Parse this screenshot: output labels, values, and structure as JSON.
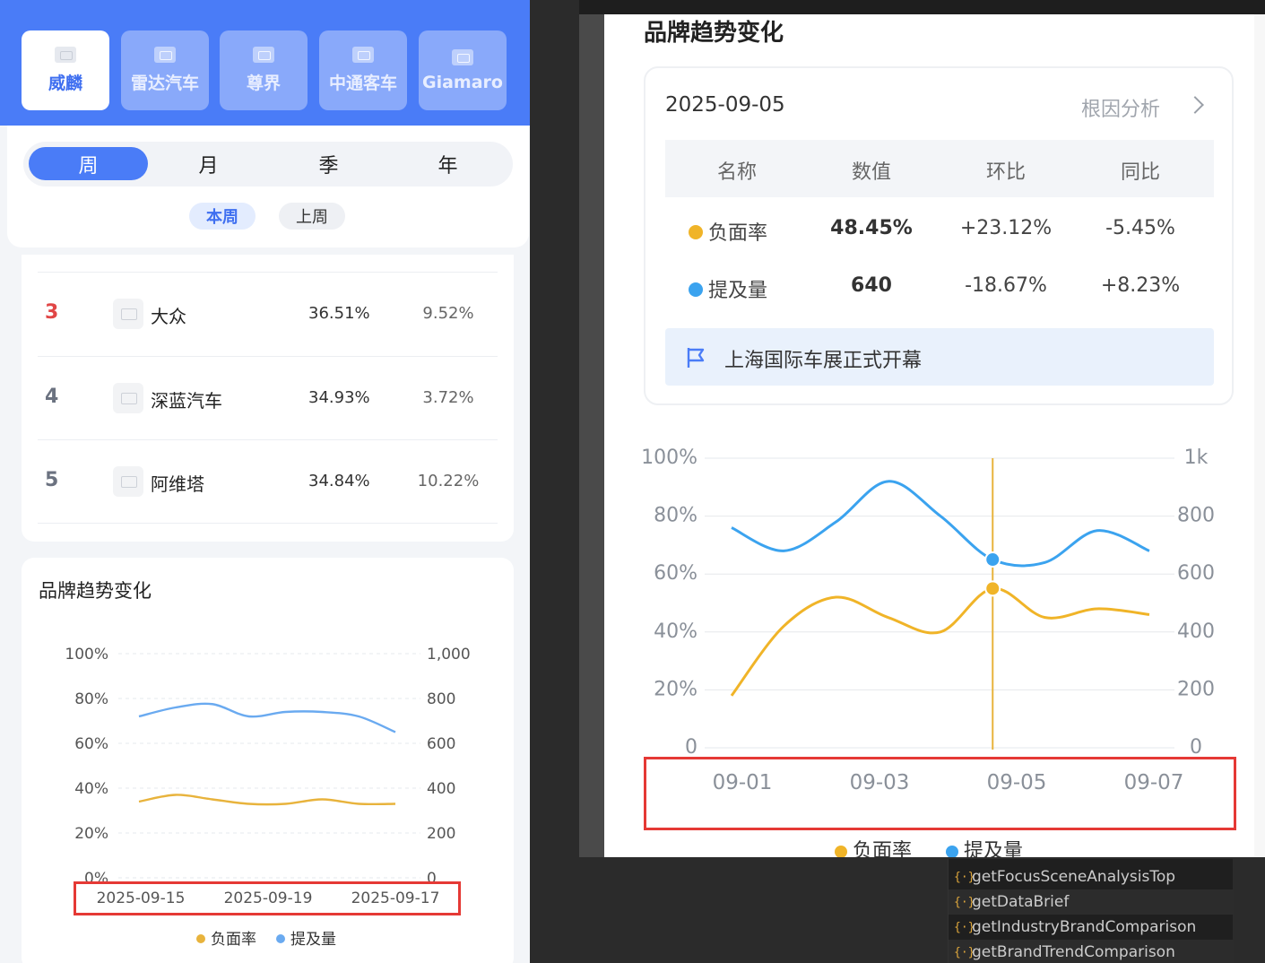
{
  "left_panel": {
    "brands": [
      "威麟",
      "雷达汽车",
      "尊界",
      "中通客车",
      "Giamaro"
    ],
    "period_tabs": [
      "周",
      "月",
      "季",
      "年"
    ],
    "sub_tabs": [
      "本周",
      "上周"
    ],
    "ranking_rows": [
      {
        "rank": "3",
        "name": "大众",
        "value1": "36.51%",
        "value2": "9.52%"
      },
      {
        "rank": "4",
        "name": "深蓝汽车",
        "value1": "34.93%",
        "value2": "3.72%"
      },
      {
        "rank": "5",
        "name": "阿维塔",
        "value1": "34.84%",
        "value2": "10.22%"
      }
    ],
    "trend_title": "品牌趋势变化"
  },
  "right_panel": {
    "title": "品牌趋势变化",
    "date": "2025-09-05",
    "root_cause_link": "根因分析",
    "table_headers": [
      "名称",
      "数值",
      "环比",
      "同比"
    ],
    "table_rows": [
      {
        "name": "负面率",
        "value": "48.45%",
        "mom": "+23.12%",
        "yoy": "-5.45%",
        "color": "#f0b428"
      },
      {
        "name": "提及量",
        "value": "640",
        "mom": "-18.67%",
        "yoy": "+8.23%",
        "color": "#3ba3ef"
      }
    ],
    "event": "上海国际车展正式开幕"
  },
  "chart_data": [
    {
      "type": "line",
      "x_labels": [
        "2025-09-15",
        "2025-09-19",
        "2025-09-17"
      ],
      "left_axis_ticks": [
        "100%",
        "80%",
        "60%",
        "40%",
        "20%",
        "0%"
      ],
      "right_axis_ticks": [
        "1,000",
        "800",
        "600",
        "400",
        "200",
        "0"
      ],
      "ylim_left": [
        0,
        100
      ],
      "ylim_right": [
        0,
        1000
      ],
      "series": [
        {
          "name": "负面率",
          "axis": "left",
          "color": "#e8b33c",
          "values": [
            34,
            37,
            35,
            33,
            33,
            35,
            33,
            33
          ]
        },
        {
          "name": "提及量",
          "axis": "right",
          "color": "#6aaaf0",
          "values": [
            720,
            760,
            775,
            720,
            740,
            740,
            720,
            650
          ]
        }
      ],
      "legend": "bottom",
      "grid": true
    },
    {
      "type": "line",
      "x_labels": [
        "09-01",
        "09-03",
        "09-05",
        "09-07"
      ],
      "left_axis_ticks": [
        "100%",
        "80%",
        "60%",
        "40%",
        "20%",
        "0"
      ],
      "right_axis_ticks": [
        "1k",
        "800",
        "600",
        "400",
        "200",
        "0"
      ],
      "ylim_left": [
        0,
        100
      ],
      "ylim_right": [
        0,
        1000
      ],
      "series": [
        {
          "name": "负面率",
          "axis": "left",
          "color": "#f0b428",
          "values": [
            18,
            42,
            52,
            45,
            40,
            55,
            45,
            48,
            46
          ]
        },
        {
          "name": "提及量",
          "axis": "right",
          "color": "#3ba3ef",
          "values": [
            760,
            680,
            780,
            920,
            800,
            650,
            640,
            750,
            680
          ]
        },
        {
          "name": "highlight",
          "axis": "left",
          "color": "#e8b33c",
          "values": []
        }
      ],
      "legend": "bottom",
      "grid": true,
      "highlight_x": "09-05"
    }
  ],
  "code_panel": {
    "items": [
      "getFocusSceneAnalysisTop",
      "getDataBrief",
      "getIndustryBrandComparison",
      "getBrandTrendComparison"
    ],
    "icon": "{·}"
  }
}
